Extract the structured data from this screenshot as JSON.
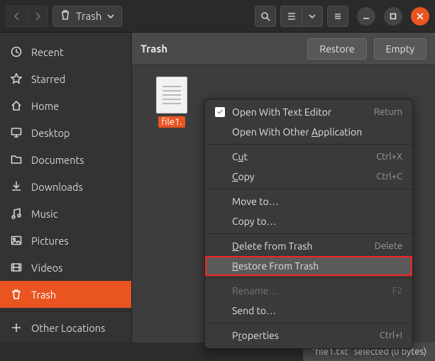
{
  "titlebar": {
    "location": "Trash"
  },
  "sidebar": {
    "items": [
      {
        "label": "Recent",
        "icon": "clock"
      },
      {
        "label": "Starred",
        "icon": "star"
      },
      {
        "label": "Home",
        "icon": "home"
      },
      {
        "label": "Desktop",
        "icon": "desktop"
      },
      {
        "label": "Documents",
        "icon": "folder"
      },
      {
        "label": "Downloads",
        "icon": "download"
      },
      {
        "label": "Music",
        "icon": "music"
      },
      {
        "label": "Pictures",
        "icon": "picture"
      },
      {
        "label": "Videos",
        "icon": "video"
      },
      {
        "label": "Trash",
        "icon": "trash"
      },
      {
        "label": "Other Locations",
        "icon": "plus"
      }
    ]
  },
  "header": {
    "title": "Trash",
    "restore": "Restore",
    "empty": "Empty"
  },
  "files": [
    {
      "name": "file1.",
      "full_name": "file1.txt"
    }
  ],
  "context_menu": {
    "items": [
      {
        "label": "Open With Text Editor",
        "accel": "Return",
        "icon": "checkbox"
      },
      {
        "label": "Open With Other Application",
        "underline_index": 16
      },
      {
        "sep": true
      },
      {
        "label": "Cut",
        "accel": "Ctrl+X",
        "underline_index": 1
      },
      {
        "label": "Copy",
        "accel": "Ctrl+C",
        "underline_index": 0
      },
      {
        "sep": true
      },
      {
        "label": "Move to…"
      },
      {
        "label": "Copy to…"
      },
      {
        "sep": true
      },
      {
        "label": "Delete from Trash",
        "accel": "Delete",
        "underline_index": 0
      },
      {
        "label": "Restore From Trash",
        "underline_index": 0,
        "highlight": true
      },
      {
        "sep": true
      },
      {
        "label": "Rename…",
        "accel": "F2",
        "disabled": true
      },
      {
        "label": "Send to…"
      },
      {
        "sep": true
      },
      {
        "label": "Properties",
        "accel": "Ctrl+I",
        "underline_index": 1
      }
    ]
  },
  "statusbar": {
    "text": "“file1.txt” selected  (0 bytes)"
  }
}
